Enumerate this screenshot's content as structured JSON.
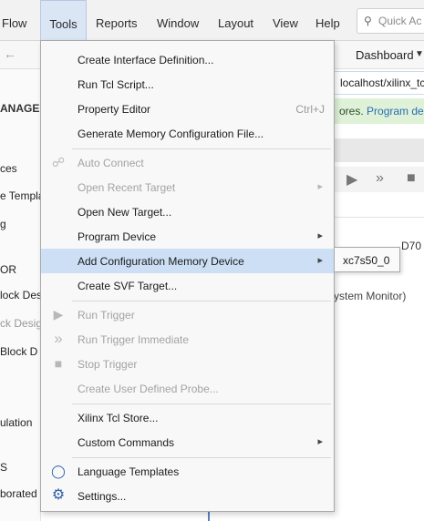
{
  "menubar": {
    "items": [
      {
        "label": "Flow"
      },
      {
        "label": "Tools"
      },
      {
        "label": "Reports"
      },
      {
        "label": "Window"
      },
      {
        "label": "Layout"
      },
      {
        "label": "View"
      },
      {
        "label": "Help"
      }
    ],
    "quick_access_placeholder": "Quick Ac"
  },
  "toolbar": {
    "layout_selector": "Dashboard"
  },
  "flow_navigator": {
    "header": "ANAGER",
    "items": [
      {
        "label": "ces"
      },
      {
        "label": "e Templa"
      },
      {
        "label": "g"
      },
      {
        "label": "OR"
      },
      {
        "label": "lock Desi"
      },
      {
        "label": "ck Desig"
      },
      {
        "label": "Block D"
      },
      {
        "label": "ulation"
      },
      {
        "label": "S"
      },
      {
        "label": "borated"
      }
    ]
  },
  "background": {
    "address": "localhost/xilinx_tcf",
    "banner_text": "ores.",
    "banner_link": "Program de",
    "hw_text": "D70",
    "sysmon_text": "ystem Monitor)"
  },
  "tools_menu": {
    "items": [
      {
        "label": "Create Interface Definition..."
      },
      {
        "label": "Run Tcl Script..."
      },
      {
        "label": "Property Editor",
        "shortcut": "Ctrl+J"
      },
      {
        "label": "Generate Memory Configuration File..."
      },
      {
        "label": "Auto Connect"
      },
      {
        "label": "Open Recent Target"
      },
      {
        "label": "Open New Target..."
      },
      {
        "label": "Program Device"
      },
      {
        "label": "Add Configuration Memory Device"
      },
      {
        "label": "Create SVF Target..."
      },
      {
        "label": "Run Trigger"
      },
      {
        "label": "Run Trigger Immediate"
      },
      {
        "label": "Stop Trigger"
      },
      {
        "label": "Create User Defined Probe..."
      },
      {
        "label": "Xilinx Tcl Store..."
      },
      {
        "label": "Custom Commands"
      },
      {
        "label": "Language Templates"
      },
      {
        "label": "Settings..."
      }
    ]
  },
  "submenu": {
    "item": "xc7s50_0"
  },
  "colors": {
    "highlight": "#cddff5",
    "active_menu": "#dbe6f5",
    "banner": "#dff2d8",
    "link": "#2b6cb8"
  }
}
